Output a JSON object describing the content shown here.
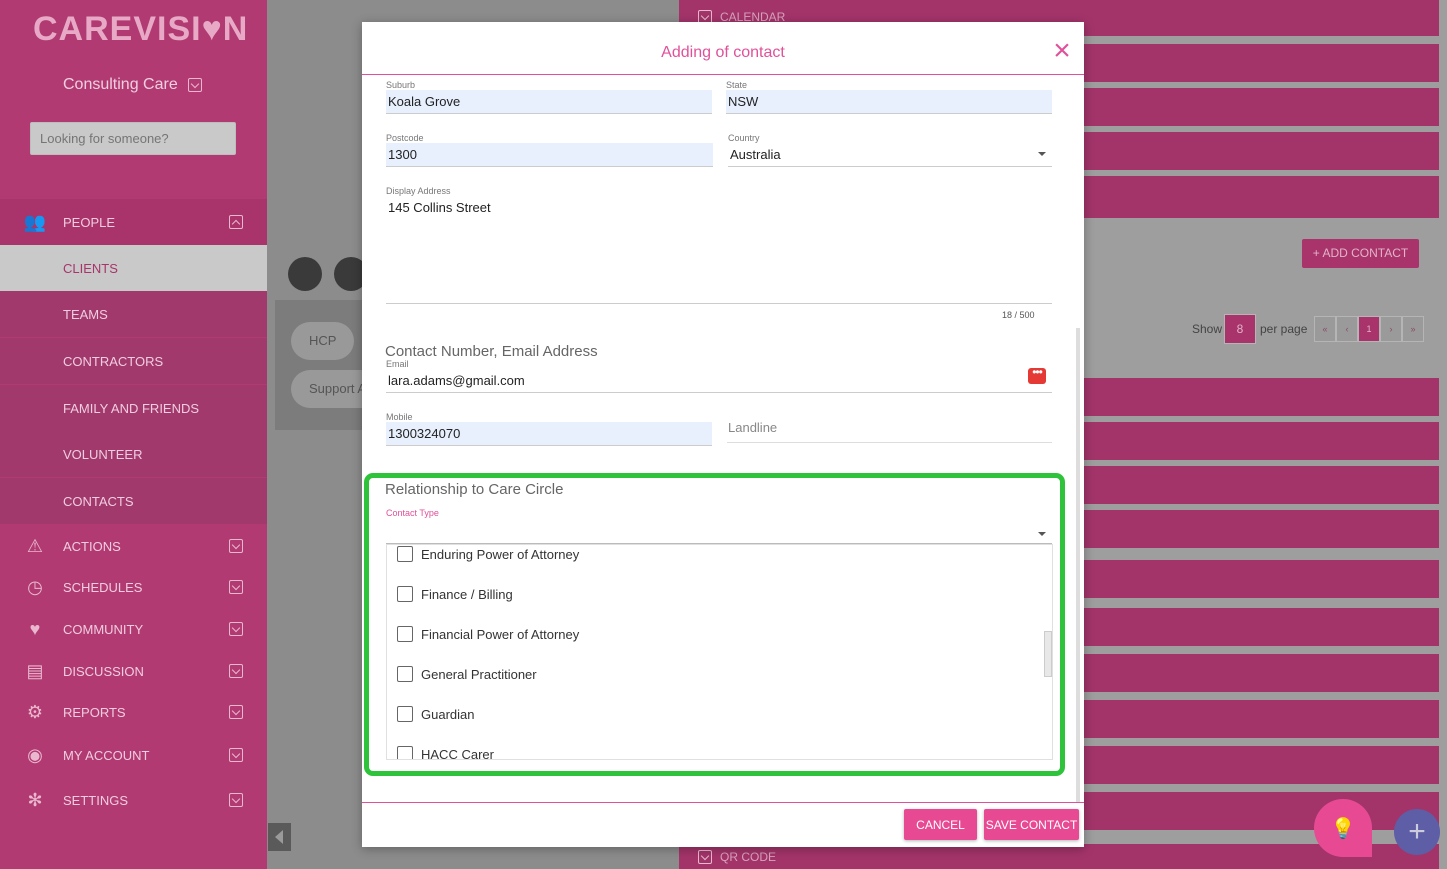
{
  "app": {
    "logo": "CAREVISI♥N",
    "org_name": "Consulting Care",
    "search_placeholder": "Looking for someone?"
  },
  "nav": {
    "people": "PEOPLE",
    "people_sub": [
      "CLIENTS",
      "TEAMS",
      "CONTRACTORS",
      "FAMILY AND FRIENDS",
      "VOLUNTEER",
      "CONTACTS"
    ],
    "items": [
      {
        "label": "ACTIONS",
        "icon": "warning-icon"
      },
      {
        "label": "SCHEDULES",
        "icon": "clock-icon"
      },
      {
        "label": "COMMUNITY",
        "icon": "heart-balloon-icon"
      },
      {
        "label": "DISCUSSION",
        "icon": "chat-icon"
      },
      {
        "label": "REPORTS",
        "icon": "reports-icon"
      },
      {
        "label": "MY ACCOUNT",
        "icon": "user-icon"
      },
      {
        "label": "SETTINGS",
        "icon": "gear-icon"
      }
    ]
  },
  "background": {
    "pills": [
      "HCP",
      "Support A"
    ],
    "calendar_label": "CALENDAR",
    "qr_label": "QR CODE",
    "add_contact": "+ ADD CONTACT",
    "show": "Show",
    "per_page_value": "8",
    "per_page": "per page",
    "pager": [
      "«",
      "‹",
      "1",
      "›",
      "»"
    ]
  },
  "modal": {
    "title": "Adding of contact",
    "suburb": {
      "label": "Suburb",
      "value": "Koala Grove"
    },
    "state": {
      "label": "State",
      "value": "NSW"
    },
    "postcode": {
      "label": "Postcode",
      "value": "1300"
    },
    "country": {
      "label": "Country",
      "value": "Australia"
    },
    "display_address": {
      "label": "Display Address",
      "value": "145 Collins Street",
      "counter": "18 / 500"
    },
    "contact_section": "Contact Number, Email Address",
    "email": {
      "label": "Email",
      "value": "lara.adams@gmail.com"
    },
    "mobile": {
      "label": "Mobile",
      "value": "1300324070"
    },
    "landline_placeholder": "Landline",
    "relationship_section": "Relationship to Care Circle",
    "contact_type_label": "Contact Type",
    "options": [
      "Enduring Power of Attorney",
      "Finance / Billing",
      "Financial Power of Attorney",
      "General Practitioner",
      "Guardian",
      "HACC Carer"
    ],
    "cancel": "CANCEL",
    "save": "SAVE CONTACT"
  },
  "colors": {
    "brand": "#e74a93",
    "sidebar": "#b23a72",
    "highlight": "#2fc33c"
  }
}
